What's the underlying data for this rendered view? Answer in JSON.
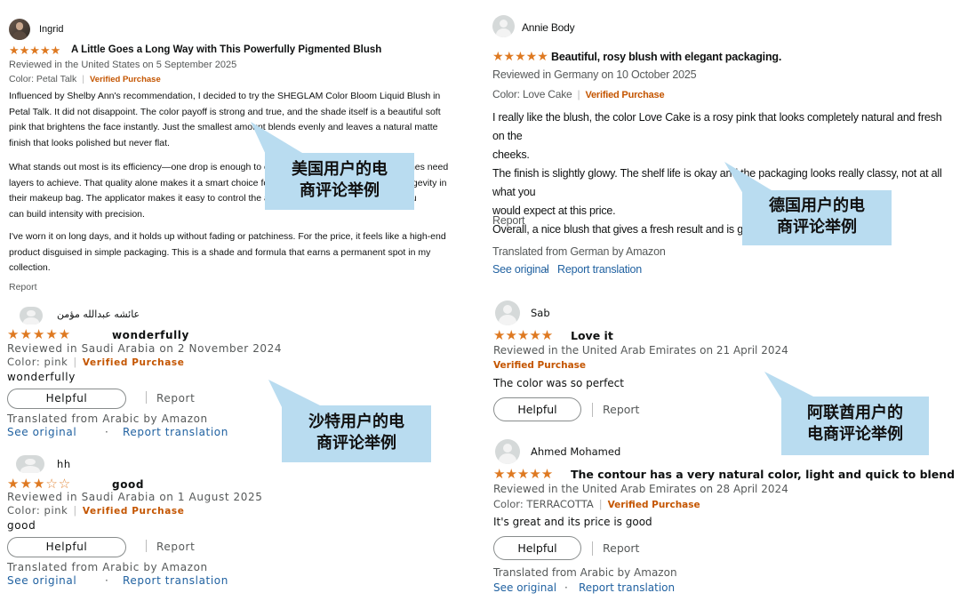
{
  "reviews": {
    "us": {
      "reviewer": "Ingrid",
      "stars": "★★★★★",
      "title": "A Little Goes a Long Way with This Powerfully Pigmented Blush",
      "reviewed_line": "Reviewed in the United States on 5 September 2025",
      "color": "Color: Petal Talk",
      "verified": "Verified Purchase",
      "p1": "Influenced by Shelby Ann's recommendation, I decided to try the SHEGLAM Color Bloom Liquid Blush in\nPetal Talk. It did not disappoint. The color payoff is strong and true, and the shade itself is a beautiful soft\npink that brightens the face instantly. Just the smallest amount blends evenly and leaves a natural matte\nfinish that looks polished but never flat.",
      "p2": "What stands out most is its efficiency—one drop is enough to cover both cheeks, while other blushes need\nlayers to achieve. That quality alone makes it a smart choice for anyone who values value and longevity in\ntheir makeup bag. The applicator makes it easy to control the amount of product, which means you\ncan build intensity with precision.",
      "p3": "I've worn it on long days, and it holds up without fading or patchiness. For the price, it feels like a high-end\nproduct disguised in simple packaging. This is a shade and formula that earns a permanent spot in my\ncollection.",
      "report": "Report"
    },
    "saudi_1": {
      "reviewer": "عائشه عبدالله مؤمن",
      "stars": "★★★★★",
      "title": "wonderfully",
      "reviewed_line": "Reviewed in Saudi Arabia on 2 November 2024",
      "color": "Color: pink",
      "verified": "Verified Purchase",
      "body": "wonderfully",
      "helpful": "Helpful",
      "report": "Report",
      "translated": "Translated from Arabic by Amazon",
      "see_original": "See original",
      "dot": "·",
      "report_translation": "Report translation"
    },
    "saudi_2": {
      "reviewer": "hh",
      "stars_on": "★★★",
      "stars_off": "☆☆",
      "title": "good",
      "reviewed_line": "Reviewed in Saudi Arabia on 1 August 2025",
      "color": "Color: pink",
      "verified": "Verified Purchase",
      "body": "good",
      "helpful": "Helpful",
      "report": "Report",
      "translated": "Translated from Arabic by Amazon",
      "see_original": "See original",
      "dot": "·",
      "report_translation": "Report translation"
    },
    "germany": {
      "reviewer": "Annie Body",
      "stars": "★★★★★",
      "title": "Beautiful, rosy blush with elegant packaging.",
      "reviewed_line": "Reviewed in Germany on 10 October 2025",
      "color": "Color: Love Cake",
      "verified": "Verified Purchase",
      "body": "I really like the blush, the color Love Cake is a rosy pink that looks completely natural and fresh on the\ncheeks.\nThe finish is slightly glowy. The shelf life is okay and the packaging looks really classy, not at all what you\nwould expect at this price.\nOverall, a nice blush that gives a fresh result and is great for everyday wear.",
      "report": "Report",
      "translated": "Translated from German by Amazon",
      "see_original": "See original",
      "dot": "·",
      "report_translation": "Report translation"
    },
    "uae_1": {
      "reviewer": "Sab",
      "stars": "★★★★★",
      "title": "Love it",
      "reviewed_line": "Reviewed in the United Arab Emirates on 21 April 2024",
      "verified": "Verified Purchase",
      "body": "The color was so perfect",
      "helpful": "Helpful",
      "report": "Report"
    },
    "uae_2": {
      "reviewer": "Ahmed Mohamed",
      "stars": "★★★★★",
      "title": "The contour has a very natural color, light and quick to blend",
      "reviewed_line": "Reviewed in the United Arab Emirates on 28 April 2024",
      "color": "Color: TERRACOTTA",
      "verified": "Verified Purchase",
      "body": "It's great and its price is good",
      "helpful": "Helpful",
      "report": "Report",
      "translated": "Translated from Arabic by Amazon",
      "see_original": "See original",
      "dot": "·",
      "report_translation": "Report translation"
    }
  },
  "callouts": {
    "us": [
      "美国用户的电",
      "商评论举例"
    ],
    "germany": [
      "德国用户的电",
      "商评论举例"
    ],
    "saudi": [
      "沙特用户的电",
      "商评论举例"
    ],
    "uae": [
      "阿联酋用户的",
      "电商评论举例"
    ]
  },
  "colors": {
    "star": "#de7921",
    "verified": "#c45500",
    "link": "#2162a1",
    "callout_bg": "#b9dcf0"
  }
}
